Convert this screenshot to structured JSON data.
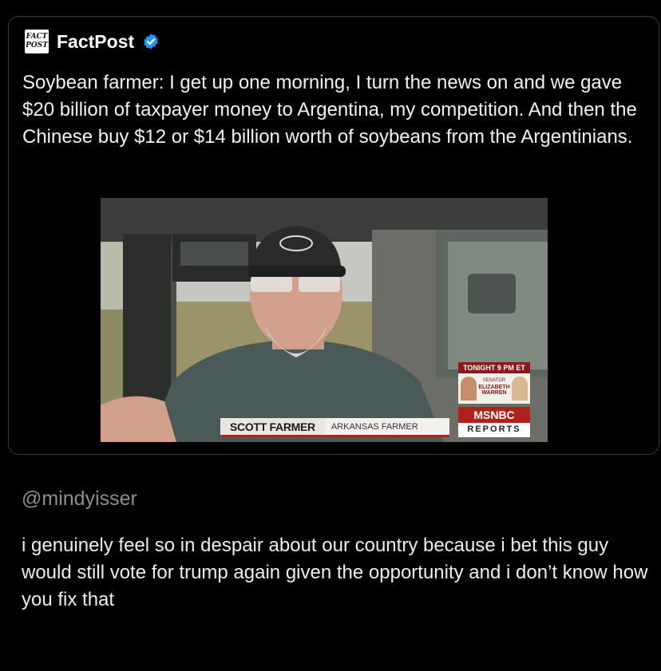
{
  "post": {
    "logo_text_top": "FACT",
    "logo_text_bottom": "POST",
    "account_name": "FactPost",
    "verified_icon": "verified-badge-icon",
    "text": "Soybean farmer: I get up one morning, I turn the news on and we gave $20 billion of taxpayer money to Argentina, my competition. And then the Chinese buy $12 or $14 billion worth of soybeans from the Argentinians."
  },
  "video": {
    "lower_third_name": "SCOTT FARMER",
    "lower_third_title": "ARKANSAS FARMER",
    "promo_header": "TONIGHT 9 PM ET",
    "promo_senator_label": "SENATOR",
    "promo_guest": "ELIZABETH WARREN",
    "network": "MSNBC",
    "network_sub": "REPORTS",
    "accent_color": "#b0211c"
  },
  "reply": {
    "handle": "@mindyisser",
    "text": "i genuinely feel so in despair about our country because i bet this guy would still vote for trump again given the opportunity and i don’t know how you fix that"
  }
}
